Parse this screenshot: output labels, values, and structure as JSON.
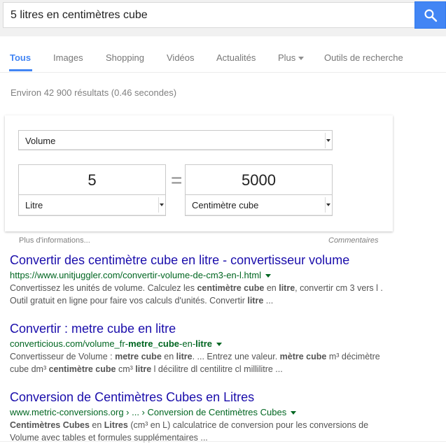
{
  "search": {
    "query": "5 litres en centimètres cube"
  },
  "tabs": [
    {
      "label": "Tous"
    },
    {
      "label": "Images"
    },
    {
      "label": "Shopping"
    },
    {
      "label": "Vidéos"
    },
    {
      "label": "Actualités"
    },
    {
      "label": "Plus"
    },
    {
      "label": "Outils de recherche"
    }
  ],
  "stats": "Environ 42 900 résultats (0.46 secondes)",
  "converter": {
    "unit_type": "Volume",
    "left_value": "5",
    "left_unit": "Litre",
    "equals": "=",
    "right_value": "5000",
    "right_unit": "Centimètre cube",
    "more_info": "Plus d'informations...",
    "feedback": "Commentaires"
  },
  "results": [
    {
      "title": "Convertir des centimètre cube en litre - convertisseur volume",
      "url": "https://www.unitjuggler.com/convertir-volume-de-cm3-en-l.html",
      "snippet_parts": [
        {
          "t": "Convertissez les unités de volume. Calculez les ",
          "b": false
        },
        {
          "t": "centimètre cube",
          "b": true
        },
        {
          "t": " en ",
          "b": false
        },
        {
          "t": "litre",
          "b": true
        },
        {
          "t": ", convertir cm 3 vers l . Outil gratuit en ligne pour faire vos calculs d'unités. Convertir ",
          "b": false
        },
        {
          "t": "litre",
          "b": true
        },
        {
          "t": " ...",
          "b": false
        }
      ]
    },
    {
      "title": "Convertir : metre cube en litre",
      "url_parts": [
        {
          "t": "converticious.com/volume_fr-",
          "b": false
        },
        {
          "t": "metre_cube",
          "b": true
        },
        {
          "t": "-en-",
          "b": false
        },
        {
          "t": "litre",
          "b": true
        }
      ],
      "snippet_parts": [
        {
          "t": "Convertisseur de Volume : ",
          "b": false
        },
        {
          "t": "metre cube",
          "b": true
        },
        {
          "t": " en ",
          "b": false
        },
        {
          "t": "litre",
          "b": true
        },
        {
          "t": ". ... Entrez une valeur. ",
          "b": false
        },
        {
          "t": "mètre cube",
          "b": true
        },
        {
          "t": " m³ décimètre cube dm³ ",
          "b": false
        },
        {
          "t": "centimètre cube",
          "b": true
        },
        {
          "t": " cm³ ",
          "b": false
        },
        {
          "t": "litre",
          "b": true
        },
        {
          "t": " l décilitre dl centilitre cl millilitre ...",
          "b": false
        }
      ]
    },
    {
      "title": "Conversion de Centimètres Cubes en Litres",
      "url": "www.metric-conversions.org › ... › Conversion de Centimètres Cubes",
      "snippet_parts": [
        {
          "t": "Centimètres Cubes",
          "b": true
        },
        {
          "t": " en ",
          "b": false
        },
        {
          "t": "Litres",
          "b": true
        },
        {
          "t": " (cm³ en L) calculatrice de conversion pour les conversions de Volume avec tables et formules supplémentaires ...",
          "b": false
        }
      ]
    }
  ]
}
